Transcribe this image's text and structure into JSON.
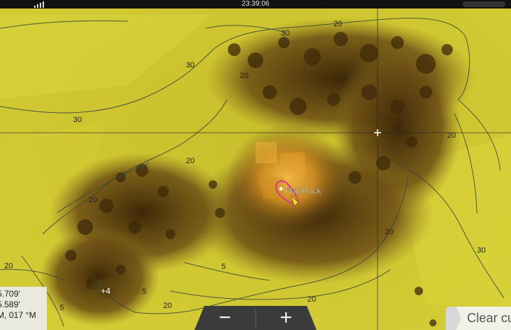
{
  "status_bar": {
    "time": "23:39:06"
  },
  "map": {
    "waypoint_label": "Flat Rock",
    "spot_marker": "+4",
    "contour_labels": [
      "30",
      "20",
      "30",
      "30",
      "20",
      "20",
      "20",
      "30",
      "20",
      "20",
      "20",
      "20",
      "5",
      "5",
      "5",
      "20",
      "30",
      "20"
    ],
    "palette": {
      "high": "#dcd63a",
      "mid": "#b6a328",
      "low": "#5a3c12",
      "peak": "#f2b33e",
      "line": "#3b4a3a"
    }
  },
  "coords_panel": {
    "line1": "5.709'",
    "line2": "5.589'",
    "line3": "M, 017 °M"
  },
  "zoom": {
    "minus": "−",
    "plus": "+"
  },
  "clear_button": {
    "label": "Clear cu"
  },
  "icons": {
    "signal": "signal-icon",
    "crosshair": "cursor-crosshair-icon",
    "waypoint": "waypoint-icon"
  }
}
